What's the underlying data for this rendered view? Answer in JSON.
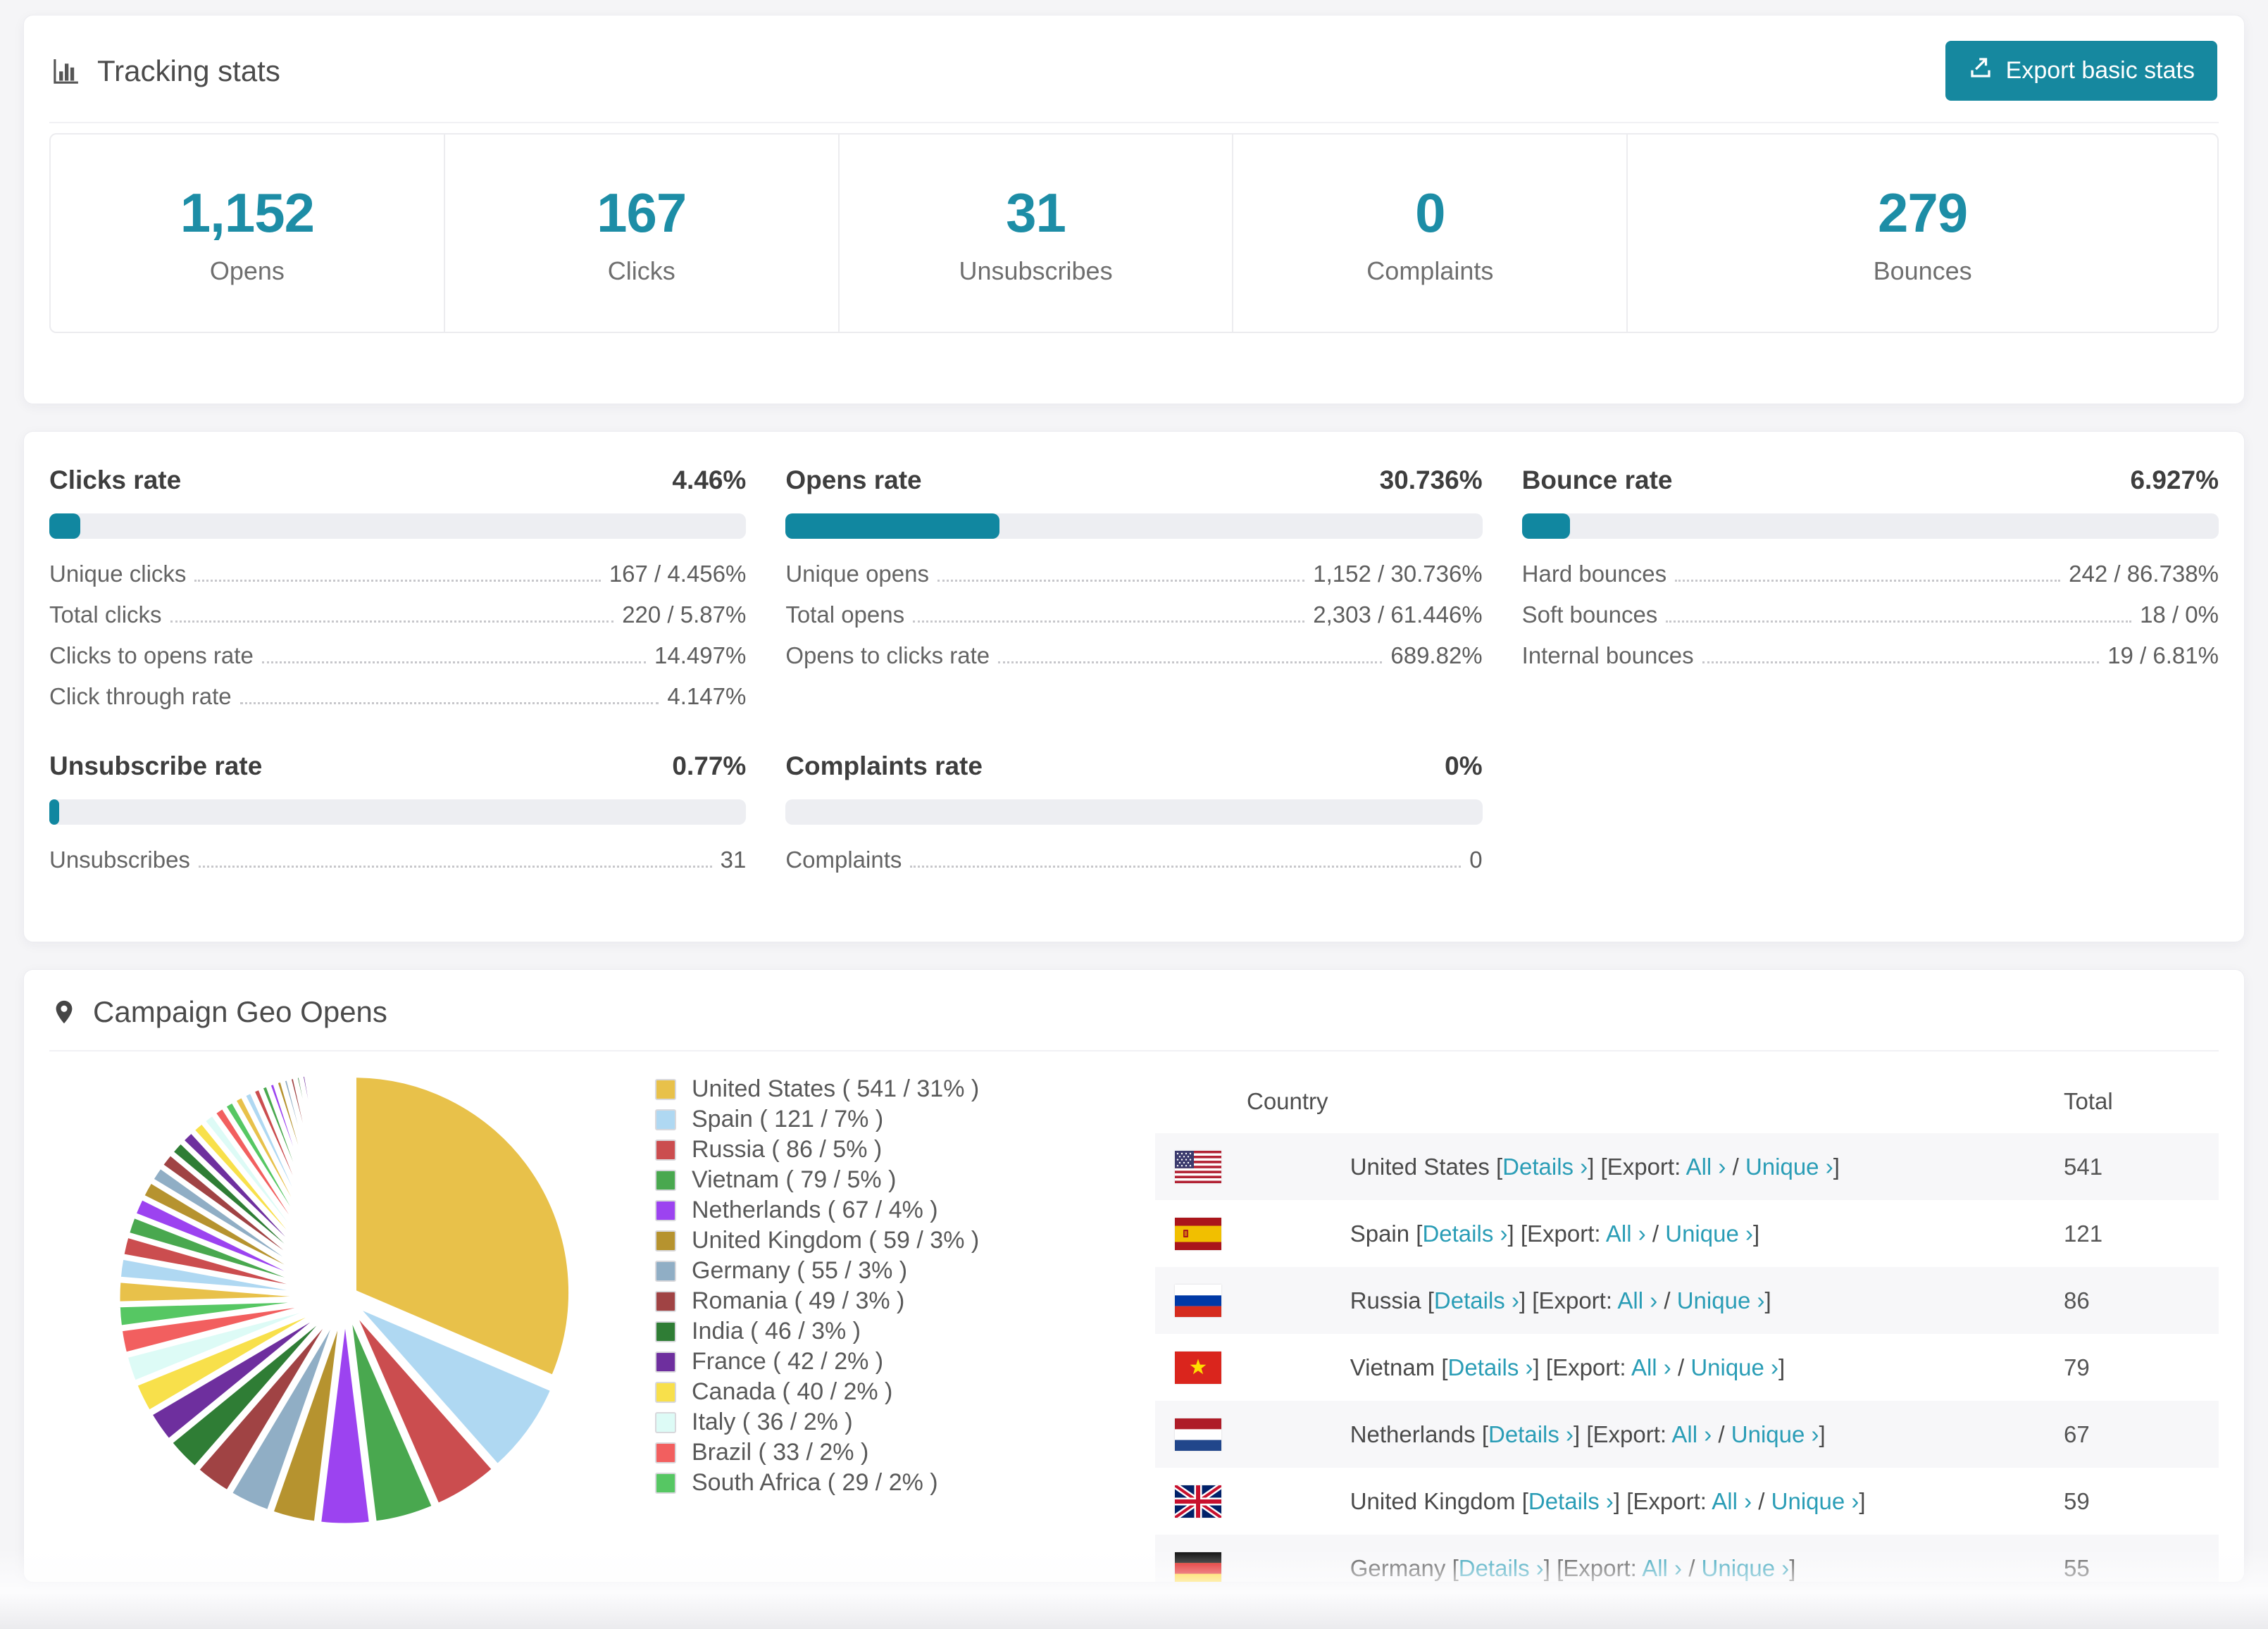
{
  "accent": "#16889f",
  "tracking": {
    "title": "Tracking stats",
    "export_label": "Export basic stats",
    "stats": [
      {
        "value": "1,152",
        "label": "Opens"
      },
      {
        "value": "167",
        "label": "Clicks"
      },
      {
        "value": "31",
        "label": "Unsubscribes"
      },
      {
        "value": "0",
        "label": "Complaints"
      },
      {
        "value": "279",
        "label": "Bounces"
      }
    ]
  },
  "rates": [
    {
      "title": "Clicks rate",
      "value": "4.46%",
      "fill": 4.46,
      "rows": [
        {
          "label": "Unique clicks",
          "value": "167 / 4.456%"
        },
        {
          "label": "Total clicks",
          "value": "220 / 5.87%"
        },
        {
          "label": "Clicks to opens rate",
          "value": "14.497%"
        },
        {
          "label": "Click through rate",
          "value": "4.147%"
        }
      ]
    },
    {
      "title": "Opens rate",
      "value": "30.736%",
      "fill": 30.736,
      "rows": [
        {
          "label": "Unique opens",
          "value": "1,152 / 30.736%"
        },
        {
          "label": "Total opens",
          "value": "2,303 / 61.446%"
        },
        {
          "label": "Opens to clicks rate",
          "value": "689.82%"
        }
      ]
    },
    {
      "title": "Bounce rate",
      "value": "6.927%",
      "fill": 6.927,
      "rows": [
        {
          "label": "Hard bounces",
          "value": "242 / 86.738%"
        },
        {
          "label": "Soft bounces",
          "value": "18 / 0%"
        },
        {
          "label": "Internal bounces",
          "value": "19 / 6.81%"
        }
      ]
    },
    {
      "title": "Unsubscribe rate",
      "value": "0.77%",
      "fill": 0.77,
      "rows": [
        {
          "label": "Unsubscribes",
          "value": "31"
        }
      ]
    },
    {
      "title": "Complaints rate",
      "value": "0%",
      "fill": 0,
      "rows": [
        {
          "label": "Complaints",
          "value": "0"
        }
      ]
    }
  ],
  "geo": {
    "title": "Campaign Geo Opens",
    "legend": [
      {
        "color": "#E8C14A",
        "label": "United States ( 541 / 31% )"
      },
      {
        "color": "#AFD8F2",
        "label": "Spain ( 121 / 7% )"
      },
      {
        "color": "#CB4D4F",
        "label": "Russia ( 86 / 5% )"
      },
      {
        "color": "#49A84F",
        "label": "Vietnam ( 79 / 5% )"
      },
      {
        "color": "#9C43F0",
        "label": "Netherlands ( 67 / 4% )"
      },
      {
        "color": "#B6932F",
        "label": "United Kingdom ( 59 / 3% )"
      },
      {
        "color": "#90AEC5",
        "label": "Germany ( 55 / 3% )"
      },
      {
        "color": "#A04344",
        "label": "Romania ( 49 / 3% )"
      },
      {
        "color": "#2F7D35",
        "label": "India ( 46 / 3% )"
      },
      {
        "color": "#6E2F9E",
        "label": "France ( 42 / 2% )"
      },
      {
        "color": "#F8E04B",
        "label": "Canada ( 40 / 2% )"
      },
      {
        "color": "#DDFBF6",
        "label": "Italy ( 36 / 2% )"
      },
      {
        "color": "#F25F5F",
        "label": "Brazil ( 33 / 2% )"
      },
      {
        "color": "#56C763",
        "label": "South Africa ( 29 / 2% )"
      }
    ],
    "table": {
      "columns": [
        "Country",
        "Total"
      ],
      "links": {
        "open": "[",
        "close": "]",
        "slash": " / ",
        "details": "Details ›",
        "export_prefix": "Export: ",
        "all": "All ›",
        "unique": "Unique ›"
      },
      "rows": [
        {
          "flag": "us",
          "country": "United States ",
          "total": "541"
        },
        {
          "flag": "es",
          "country": "Spain ",
          "total": "121"
        },
        {
          "flag": "ru",
          "country": "Russia ",
          "total": "86"
        },
        {
          "flag": "vn",
          "country": "Vietnam ",
          "total": "79"
        },
        {
          "flag": "nl",
          "country": "Netherlands ",
          "total": "67"
        },
        {
          "flag": "gb",
          "country": "United Kingdom ",
          "total": "59"
        },
        {
          "flag": "de",
          "country": "Germany ",
          "total": "55"
        }
      ]
    }
  },
  "chart_data": {
    "type": "pie",
    "title": "Campaign Geo Opens",
    "unit": "opens",
    "start_angle": "top",
    "direction": "clockwise",
    "legend_position": "right",
    "slices": [
      {
        "label": "United States",
        "value": 541,
        "pct": 31
      },
      {
        "label": "Spain",
        "value": 121,
        "pct": 7
      },
      {
        "label": "Russia",
        "value": 86,
        "pct": 5
      },
      {
        "label": "Vietnam",
        "value": 79,
        "pct": 5
      },
      {
        "label": "Netherlands",
        "value": 67,
        "pct": 4
      },
      {
        "label": "United Kingdom",
        "value": 59,
        "pct": 3
      },
      {
        "label": "Germany",
        "value": 55,
        "pct": 3
      },
      {
        "label": "Romania",
        "value": 49,
        "pct": 3
      },
      {
        "label": "India",
        "value": 46,
        "pct": 3
      },
      {
        "label": "France",
        "value": 42,
        "pct": 2
      },
      {
        "label": "Canada",
        "value": 40,
        "pct": 2
      },
      {
        "label": "Italy",
        "value": 36,
        "pct": 2
      },
      {
        "label": "Brazil",
        "value": 33,
        "pct": 2
      },
      {
        "label": "South Africa",
        "value": 29,
        "pct": 2
      }
    ],
    "others_estimated": [
      30,
      28,
      27,
      25,
      24,
      23,
      21,
      20,
      19,
      18,
      17,
      16,
      15,
      14,
      13,
      12,
      11,
      10,
      9,
      9,
      8,
      8,
      7,
      7,
      6,
      6,
      5,
      5,
      4,
      4,
      3,
      3,
      2,
      2,
      2,
      1,
      1,
      1,
      1,
      1
    ],
    "palette": [
      "#E8C14A",
      "#AFD8F2",
      "#CB4D4F",
      "#49A84F",
      "#9C43F0",
      "#B6932F",
      "#90AEC5",
      "#A04344",
      "#2F7D35",
      "#6E2F9E",
      "#F8E04B",
      "#DDFBF6",
      "#F25F5F",
      "#56C763"
    ]
  }
}
